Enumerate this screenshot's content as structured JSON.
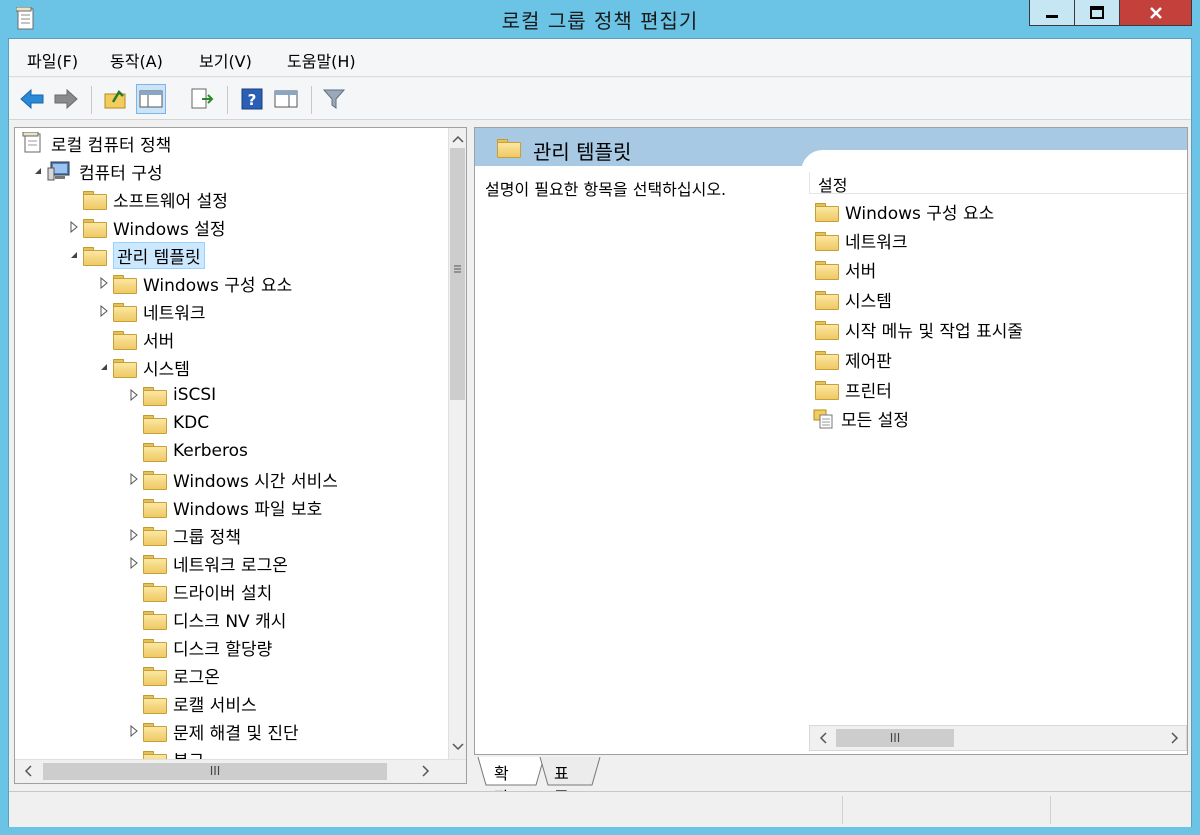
{
  "window": {
    "title": "로컬 그룹 정책 편집기"
  },
  "menu": {
    "file": "파일(F)",
    "action": "동작(A)",
    "view": "보기(V)",
    "help": "도움말(H)"
  },
  "toolbar": {
    "icons": [
      "back-arrow-icon",
      "forward-arrow-icon",
      "up-folder-icon",
      "show-hide-tree-icon",
      "export-list-icon",
      "help-icon",
      "show-hide-action-pane-icon",
      "filter-icon"
    ]
  },
  "tree": {
    "root": "로컬 컴퓨터 정책",
    "computer_config": "컴퓨터 구성",
    "software_settings": "소프트웨어 설정",
    "windows_settings": "Windows 설정",
    "admin_templates": "관리 템플릿",
    "windows_components": "Windows 구성 요소",
    "network": "네트워크",
    "server": "서버",
    "system": "시스템",
    "iscsi": "iSCSI",
    "kdc": "KDC",
    "kerberos": "Kerberos",
    "time_service": "Windows 시간 서비스",
    "file_protection": "Windows 파일 보호",
    "group_policy": "그룹 정책",
    "net_logon": "네트워크 로그온",
    "driver_install": "드라이버 설치",
    "disk_nv_cache": "디스크 NV 캐시",
    "disk_quota": "디스크 할당량",
    "logon": "로그온",
    "local_services": "로캘 서비스",
    "troubleshoot": "문제 해결 및 진단",
    "partial": "복구"
  },
  "right": {
    "header_title": "관리 템플릿",
    "description": "설명이 필요한 항목을 선택하십시오.",
    "column_header": "설정",
    "items": [
      "Windows 구성 요소",
      "네트워크",
      "서버",
      "시스템",
      "시작 메뉴 및 작업 표시줄",
      "제어판",
      "프린터",
      "모든 설정"
    ]
  },
  "tabs": {
    "extended": "확장",
    "standard": "표준"
  },
  "scroll": {
    "grip": "III"
  }
}
